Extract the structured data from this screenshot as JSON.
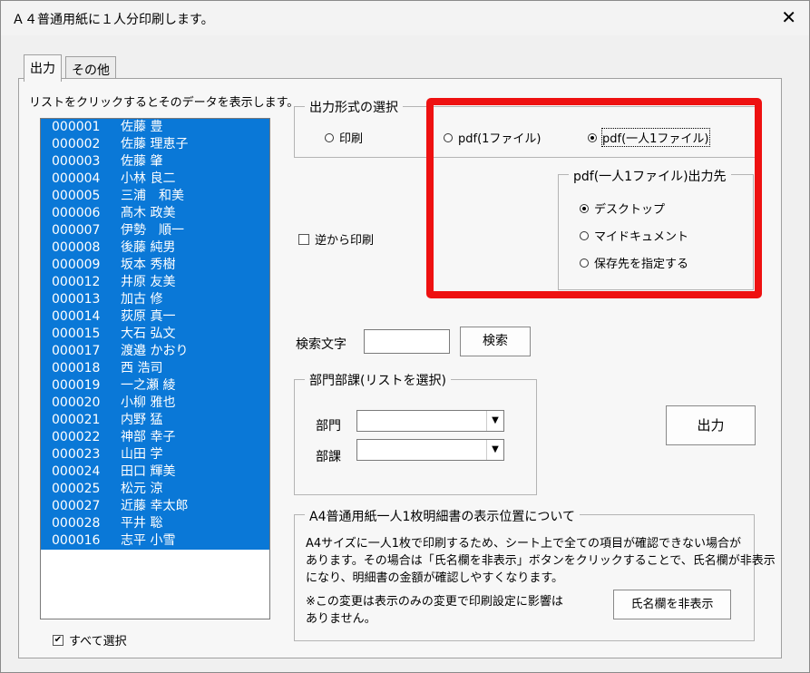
{
  "window": {
    "title": "Ａ４普通用紙に１人分印刷します。"
  },
  "tabs": [
    {
      "label": "出力"
    },
    {
      "label": "その他"
    }
  ],
  "list": {
    "hint": "リストをクリックするとそのデータを表示します。",
    "rows": [
      {
        "id": "000001",
        "name": "佐藤 豊"
      },
      {
        "id": "000002",
        "name": "佐藤 理恵子"
      },
      {
        "id": "000003",
        "name": "佐藤 肇"
      },
      {
        "id": "000004",
        "name": "小林 良二"
      },
      {
        "id": "000005",
        "name": "三浦　和美"
      },
      {
        "id": "000006",
        "name": "髙木 政美"
      },
      {
        "id": "000007",
        "name": "伊勢　順一"
      },
      {
        "id": "000008",
        "name": "後藤 純男"
      },
      {
        "id": "000009",
        "name": "坂本 秀樹"
      },
      {
        "id": "000012",
        "name": "井原 友美"
      },
      {
        "id": "000013",
        "name": "加古 修"
      },
      {
        "id": "000014",
        "name": "荻原 真一"
      },
      {
        "id": "000015",
        "name": "大石 弘文"
      },
      {
        "id": "000017",
        "name": "渡邉 かおり"
      },
      {
        "id": "000018",
        "name": "西 浩司"
      },
      {
        "id": "000019",
        "name": "一之瀬 綾"
      },
      {
        "id": "000020",
        "name": "小柳 雅也"
      },
      {
        "id": "000021",
        "name": "内野 猛"
      },
      {
        "id": "000022",
        "name": "神部 幸子"
      },
      {
        "id": "000023",
        "name": "山田 学"
      },
      {
        "id": "000024",
        "name": "田口 輝美"
      },
      {
        "id": "000025",
        "name": "松元 涼"
      },
      {
        "id": "000027",
        "name": "近藤 幸太郎"
      },
      {
        "id": "000028",
        "name": "平井 聡"
      },
      {
        "id": "000016",
        "name": "志平 小雪"
      }
    ],
    "select_all": {
      "label": "すべて選択",
      "checked": true
    }
  },
  "output_format": {
    "title": "出力形式の選択",
    "options": [
      {
        "label": "印刷",
        "selected": false
      },
      {
        "label": "pdf(1ファイル)",
        "selected": false
      },
      {
        "label": "pdf(一人1ファイル)",
        "selected": true
      }
    ]
  },
  "pdf_dest": {
    "title": "pdf(一人1ファイル)出力先",
    "options": [
      {
        "label": "デスクトップ",
        "selected": true
      },
      {
        "label": "マイドキュメント",
        "selected": false
      },
      {
        "label": "保存先を指定する",
        "selected": false
      }
    ]
  },
  "reverse_print": {
    "label": "逆から印刷",
    "checked": false
  },
  "search": {
    "label": "検索文字",
    "value": "",
    "button": "検索"
  },
  "dept": {
    "title": "部門部課(リストを選択)",
    "division_label": "部門",
    "division_value": "",
    "section_label": "部課",
    "section_value": ""
  },
  "output_button": "出力",
  "notice": {
    "title": "A4普通用紙一人1枚明細書の表示位置について",
    "line1": "A4サイズに一人1枚で印刷するため、シート上で全ての項目が確認できない場合が",
    "line2": "あります。その場合は「氏名欄を非表示」ボタンをクリックすることで、氏名欄が非表示",
    "line3": "になり、明細書の金額が確認しやすくなります。",
    "line4": "※この変更は表示のみの変更で印刷設定に影響は",
    "line5": "ありません。",
    "hide_button": "氏名欄を非表示"
  },
  "colors": {
    "selection": "#0a78d7",
    "highlight_border": "#e11111"
  }
}
